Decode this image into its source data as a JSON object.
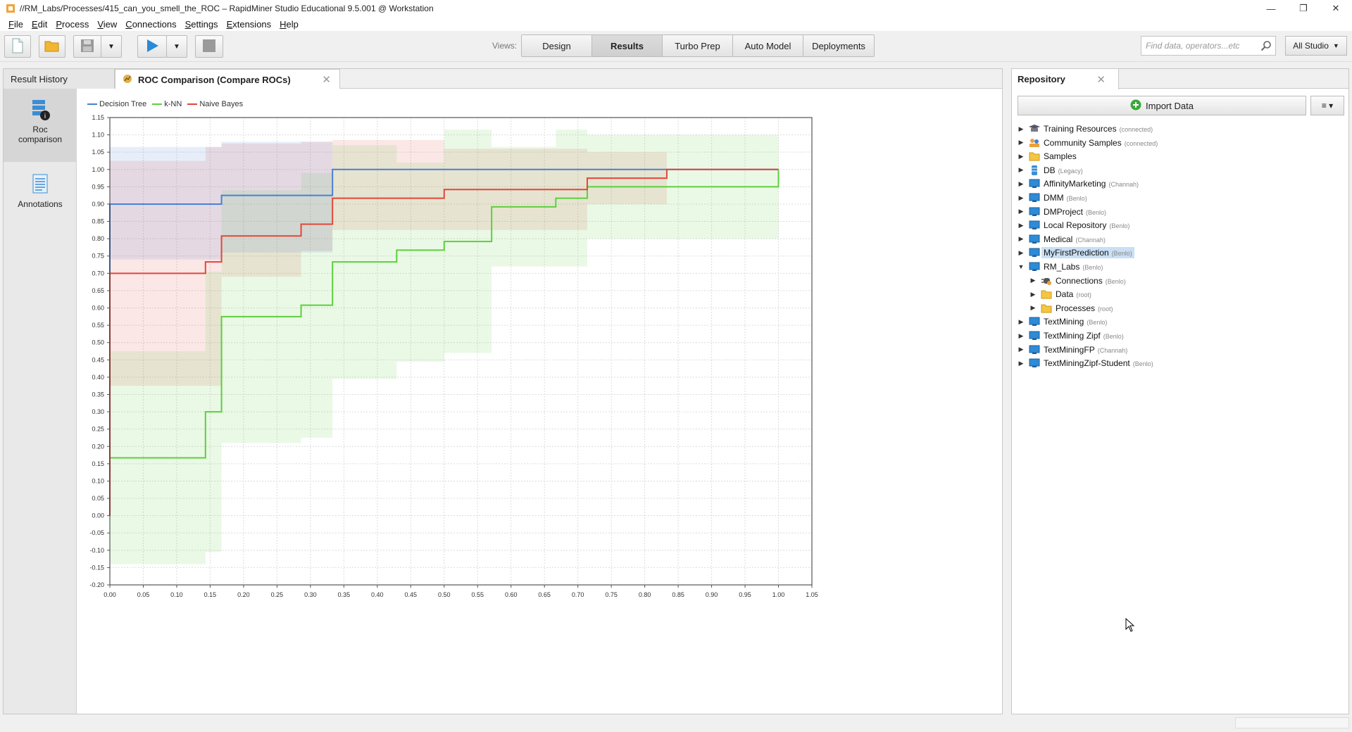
{
  "window": {
    "title": "//RM_Labs/Processes/415_can_you_smell_the_ROC – RapidMiner Studio Educational 9.5.001 @ Workstation",
    "controls": [
      "—",
      "❐",
      "✕"
    ]
  },
  "menu": [
    {
      "label": "File",
      "u": "F",
      "rest": "ile"
    },
    {
      "label": "Edit",
      "u": "E",
      "rest": "dit"
    },
    {
      "label": "Process",
      "u": "P",
      "rest": "rocess"
    },
    {
      "label": "View",
      "u": "V",
      "rest": "iew"
    },
    {
      "label": "Connections",
      "u": "C",
      "rest": "onnections"
    },
    {
      "label": "Settings",
      "u": "S",
      "rest": "ettings"
    },
    {
      "label": "Extensions",
      "u": "E",
      "rest": "xtensions"
    },
    {
      "label": "Help",
      "u": "H",
      "rest": "elp"
    }
  ],
  "toolbar": {
    "views_label": "Views:",
    "views": [
      "Design",
      "Results",
      "Turbo Prep",
      "Auto Model",
      "Deployments"
    ],
    "active_view": "Results",
    "search_placeholder": "Find data, operators...etc",
    "studio_label": "All Studio"
  },
  "results": {
    "tabs": [
      "Result History",
      "ROC Comparison (Compare ROCs)"
    ],
    "active_tab": "ROC Comparison (Compare ROCs)",
    "side_items": [
      {
        "label1": "Roc",
        "label2": "comparison"
      },
      {
        "label1": "Annotations",
        "label2": ""
      }
    ]
  },
  "chart_data": {
    "type": "line",
    "title": "",
    "xlabel": "",
    "ylabel": "",
    "xlim": [
      0.0,
      1.05
    ],
    "ylim": [
      -0.2,
      1.15
    ],
    "xticks": [
      "0.00",
      "0.05",
      "0.10",
      "0.15",
      "0.20",
      "0.25",
      "0.30",
      "0.35",
      "0.40",
      "0.45",
      "0.50",
      "0.55",
      "0.60",
      "0.65",
      "0.70",
      "0.75",
      "0.80",
      "0.85",
      "0.90",
      "0.95",
      "1.00",
      "1.05"
    ],
    "yticks": [
      "1.15",
      "1.10",
      "1.05",
      "1.00",
      "0.95",
      "0.90",
      "0.85",
      "0.80",
      "0.75",
      "0.70",
      "0.65",
      "0.60",
      "0.55",
      "0.50",
      "0.45",
      "0.40",
      "0.35",
      "0.30",
      "0.25",
      "0.20",
      "0.15",
      "0.10",
      "0.05",
      "0.00",
      "-0.05",
      "-0.10",
      "-0.15",
      "-0.20"
    ],
    "grid": true,
    "legend": "top-left",
    "series": [
      {
        "name": "Decision Tree",
        "color": "#4a7fd4",
        "x": [
          0.0,
          0.0,
          0.167,
          0.167,
          0.333,
          0.333,
          1.0
        ],
        "y": [
          0.0,
          0.9,
          0.9,
          0.925,
          0.925,
          1.0,
          1.0
        ]
      },
      {
        "name": "k-NN",
        "color": "#5ccf3c",
        "x": [
          0.0,
          0.0,
          0.143,
          0.143,
          0.167,
          0.167,
          0.286,
          0.286,
          0.333,
          0.333,
          0.429,
          0.429,
          0.5,
          0.5,
          0.571,
          0.571,
          0.667,
          0.667,
          0.714,
          0.714,
          1.0,
          1.0
        ],
        "y": [
          0.0,
          0.167,
          0.167,
          0.3,
          0.3,
          0.575,
          0.575,
          0.608,
          0.608,
          0.733,
          0.733,
          0.767,
          0.767,
          0.792,
          0.792,
          0.892,
          0.892,
          0.917,
          0.917,
          0.95,
          0.95,
          1.0
        ]
      },
      {
        "name": "Naive Bayes",
        "color": "#e2463b",
        "x": [
          0.0,
          0.0,
          0.143,
          0.143,
          0.167,
          0.167,
          0.286,
          0.286,
          0.333,
          0.333,
          0.5,
          0.5,
          0.714,
          0.714,
          0.833,
          0.833,
          1.0
        ],
        "y": [
          0.0,
          0.7,
          0.7,
          0.733,
          0.733,
          0.808,
          0.808,
          0.842,
          0.842,
          0.917,
          0.917,
          0.942,
          0.942,
          0.975,
          0.975,
          1.0,
          1.0
        ]
      }
    ],
    "bands": [
      {
        "series": "Naive Bayes",
        "color": "#e2463b",
        "rects": [
          [
            0.0,
            0.143,
            0.375,
            1.025
          ],
          [
            0.143,
            0.167,
            0.375,
            1.065
          ],
          [
            0.167,
            0.286,
            0.69,
            1.075
          ],
          [
            0.286,
            0.333,
            0.765,
            1.08
          ],
          [
            0.333,
            0.5,
            0.825,
            1.085
          ],
          [
            0.5,
            0.714,
            0.825,
            1.06
          ],
          [
            0.714,
            0.833,
            0.9,
            1.05
          ]
        ]
      },
      {
        "series": "k-NN",
        "color": "#5ccf3c",
        "rects": [
          [
            0.0,
            0.143,
            -0.14,
            0.475
          ],
          [
            0.143,
            0.167,
            -0.105,
            0.705
          ],
          [
            0.167,
            0.286,
            0.21,
            0.94
          ],
          [
            0.286,
            0.333,
            0.225,
            0.99
          ],
          [
            0.333,
            0.429,
            0.395,
            1.07
          ],
          [
            0.429,
            0.5,
            0.445,
            1.02
          ],
          [
            0.5,
            0.571,
            0.47,
            1.115
          ],
          [
            0.571,
            0.667,
            0.72,
            1.065
          ],
          [
            0.667,
            0.714,
            0.72,
            1.115
          ],
          [
            0.714,
            1.0,
            0.8,
            1.1
          ]
        ]
      },
      {
        "series": "Decision Tree",
        "color": "#4a7fd4",
        "rects": [
          [
            0.0,
            0.143,
            0.74,
            1.065
          ],
          [
            0.143,
            0.167,
            0.74,
            1.065
          ],
          [
            0.167,
            0.333,
            0.76,
            1.08
          ]
        ]
      }
    ]
  },
  "repository": {
    "tab_label": "Repository",
    "import_label": "Import Data",
    "menu_label": "≡ ▾",
    "items": [
      {
        "label": "Training Resources",
        "sub": "(connected)",
        "icon": "graduation-icon",
        "level": 0,
        "expanded": false
      },
      {
        "label": "Community Samples",
        "sub": "(connected)",
        "icon": "community-icon",
        "level": 0,
        "expanded": false
      },
      {
        "label": "Samples",
        "sub": "",
        "icon": "folder-icon",
        "level": 0,
        "expanded": false
      },
      {
        "label": "DB",
        "sub": "(Legacy)",
        "icon": "database-icon",
        "level": 0,
        "expanded": false
      },
      {
        "label": "AffinityMarketing",
        "sub": "(Channah)",
        "icon": "monitor-icon",
        "level": 0,
        "expanded": false
      },
      {
        "label": "DMM",
        "sub": "(Benlo)",
        "icon": "monitor-icon",
        "level": 0,
        "expanded": false
      },
      {
        "label": "DMProject",
        "sub": "(Benlo)",
        "icon": "monitor-icon",
        "level": 0,
        "expanded": false
      },
      {
        "label": "Local Repository",
        "sub": "(Benlo)",
        "icon": "monitor-icon",
        "level": 0,
        "expanded": false
      },
      {
        "label": "Medical",
        "sub": "(Channah)",
        "icon": "monitor-icon",
        "level": 0,
        "expanded": false
      },
      {
        "label": "MyFirstPrediction",
        "sub": "(Benlo)",
        "icon": "monitor-icon",
        "level": 0,
        "expanded": false,
        "selected": true
      },
      {
        "label": "RM_Labs",
        "sub": "(Benlo)",
        "icon": "monitor-icon",
        "level": 0,
        "expanded": true
      },
      {
        "label": "Connections",
        "sub": "(Benlo)",
        "icon": "plug-icon",
        "level": 1,
        "expanded": false
      },
      {
        "label": "Data",
        "sub": "(root)",
        "icon": "folder-icon",
        "level": 1,
        "expanded": false
      },
      {
        "label": "Processes",
        "sub": "(root)",
        "icon": "folder-icon",
        "level": 1,
        "expanded": false
      },
      {
        "label": "TextMining",
        "sub": "(Benlo)",
        "icon": "monitor-icon",
        "level": 0,
        "expanded": false
      },
      {
        "label": "TextMining Zipf",
        "sub": "(Benlo)",
        "icon": "monitor-icon",
        "level": 0,
        "expanded": false
      },
      {
        "label": "TextMiningFP",
        "sub": "(Channah)",
        "icon": "monitor-icon",
        "level": 0,
        "expanded": false
      },
      {
        "label": "TextMiningZipf-Student",
        "sub": "(Benlo)",
        "icon": "monitor-icon",
        "level": 0,
        "expanded": false
      }
    ]
  },
  "colors": {
    "accent": "#3b8ed6",
    "selected": "#c9dff5",
    "play": "#2a8ad8"
  }
}
